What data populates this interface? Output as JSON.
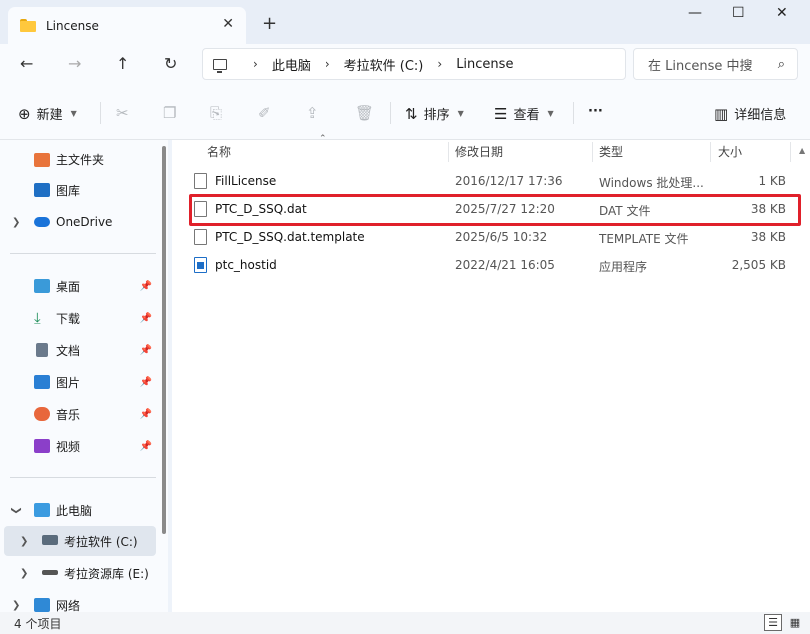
{
  "window": {
    "tab_title": "Lincense",
    "tab_close": "✕",
    "new_tab": "+",
    "minimize": "—",
    "maximize": "☐",
    "close": "✕"
  },
  "nav": {
    "back": "←",
    "forward": "→",
    "up": "↑",
    "refresh": "↻"
  },
  "breadcrumb": [
    "此电脑",
    "考拉软件 (C:)",
    "Lincense"
  ],
  "breadcrumb_sep": "›",
  "search": {
    "placeholder": "在 Lincense 中搜"
  },
  "toolbar": {
    "new_label": "新建",
    "sort_label": "排序",
    "view_label": "查看",
    "more_label": "···",
    "details_label": "详细信息"
  },
  "sidebar": {
    "items": [
      {
        "label": "主文件夹",
        "icon": "home-icon"
      },
      {
        "label": "图库",
        "icon": "gallery-icon"
      },
      {
        "label": "OneDrive",
        "icon": "cloud-icon"
      },
      {
        "label": "桌面",
        "icon": "desktop-icon"
      },
      {
        "label": "下载",
        "icon": "download-icon"
      },
      {
        "label": "文档",
        "icon": "document-icon"
      },
      {
        "label": "图片",
        "icon": "pictures-icon"
      },
      {
        "label": "音乐",
        "icon": "music-icon"
      },
      {
        "label": "视频",
        "icon": "video-icon"
      },
      {
        "label": "此电脑",
        "icon": "pc-icon"
      },
      {
        "label": "考拉软件 (C:)",
        "icon": "drive-c-icon"
      },
      {
        "label": "考拉资源库 (E:)",
        "icon": "drive-e-icon"
      },
      {
        "label": "网络",
        "icon": "network-icon"
      }
    ]
  },
  "columns": {
    "name": "名称",
    "date": "修改日期",
    "type": "类型",
    "size": "大小"
  },
  "files": [
    {
      "name": "FillLicense",
      "date": "2016/12/17 17:36",
      "type": "Windows 批处理...",
      "size": "1 KB",
      "icon": "batch-file-icon"
    },
    {
      "name": "PTC_D_SSQ.dat",
      "date": "2025/7/27 12:20",
      "type": "DAT 文件",
      "size": "38 KB",
      "icon": "file-icon"
    },
    {
      "name": "PTC_D_SSQ.dat.template",
      "date": "2025/6/5 10:32",
      "type": "TEMPLATE 文件",
      "size": "38 KB",
      "icon": "file-icon"
    },
    {
      "name": "ptc_hostid",
      "date": "2022/4/21 16:05",
      "type": "应用程序",
      "size": "2,505 KB",
      "icon": "app-icon"
    }
  ],
  "status": {
    "count": "4 个项目"
  },
  "colors": {
    "highlight": "#e0202a",
    "accent": "#1d6ec7",
    "folder": "#ffc83d"
  }
}
